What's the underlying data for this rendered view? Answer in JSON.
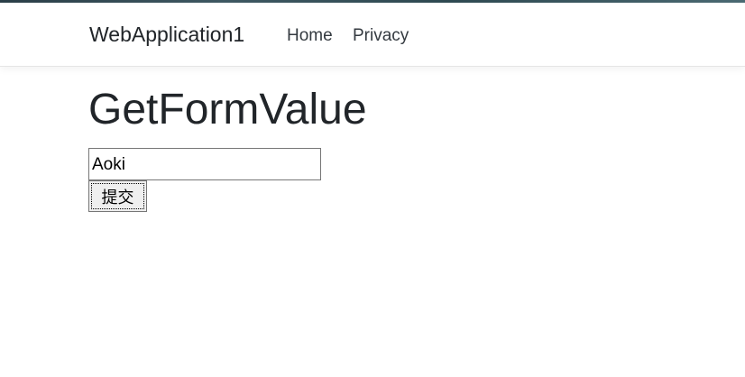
{
  "navbar": {
    "brand": "WebApplication1",
    "links": [
      {
        "label": "Home"
      },
      {
        "label": "Privacy"
      }
    ]
  },
  "main": {
    "title": "GetFormValue",
    "input": {
      "value": "Aoki"
    },
    "submit_label": "提交"
  }
}
